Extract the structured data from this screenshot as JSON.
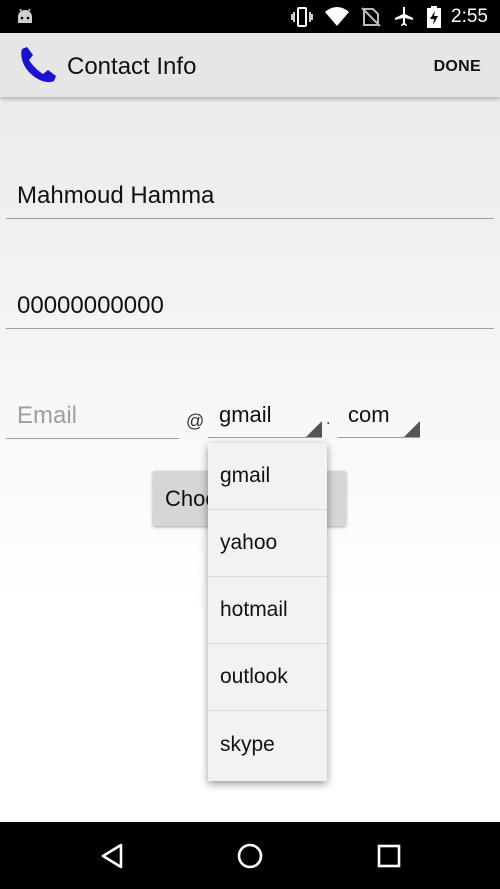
{
  "status_bar": {
    "time": "2:55",
    "icons": [
      "android-debug-icon",
      "vibrate-icon",
      "wifi-icon",
      "no-sim-icon",
      "airplane-mode-icon",
      "battery-charging-icon"
    ]
  },
  "app_bar": {
    "title": "Contact Info",
    "done_label": "DONE",
    "logo_icon": "phone-handset-icon",
    "logo_color": "#1a11d6"
  },
  "form": {
    "name_value": "Mahmoud Hamma",
    "phone_value": "00000000000",
    "email_placeholder": "Email",
    "at_label": "@",
    "domain_selected": "gmail",
    "dot_label": ".",
    "tld_selected": "com",
    "choose_button_label": "Choose Image"
  },
  "dropdown": {
    "options": [
      "gmail",
      "yahoo",
      "hotmail",
      "outlook",
      "skype"
    ]
  },
  "nav_bar": {
    "icons": [
      "back-icon",
      "home-icon",
      "recents-icon"
    ]
  }
}
